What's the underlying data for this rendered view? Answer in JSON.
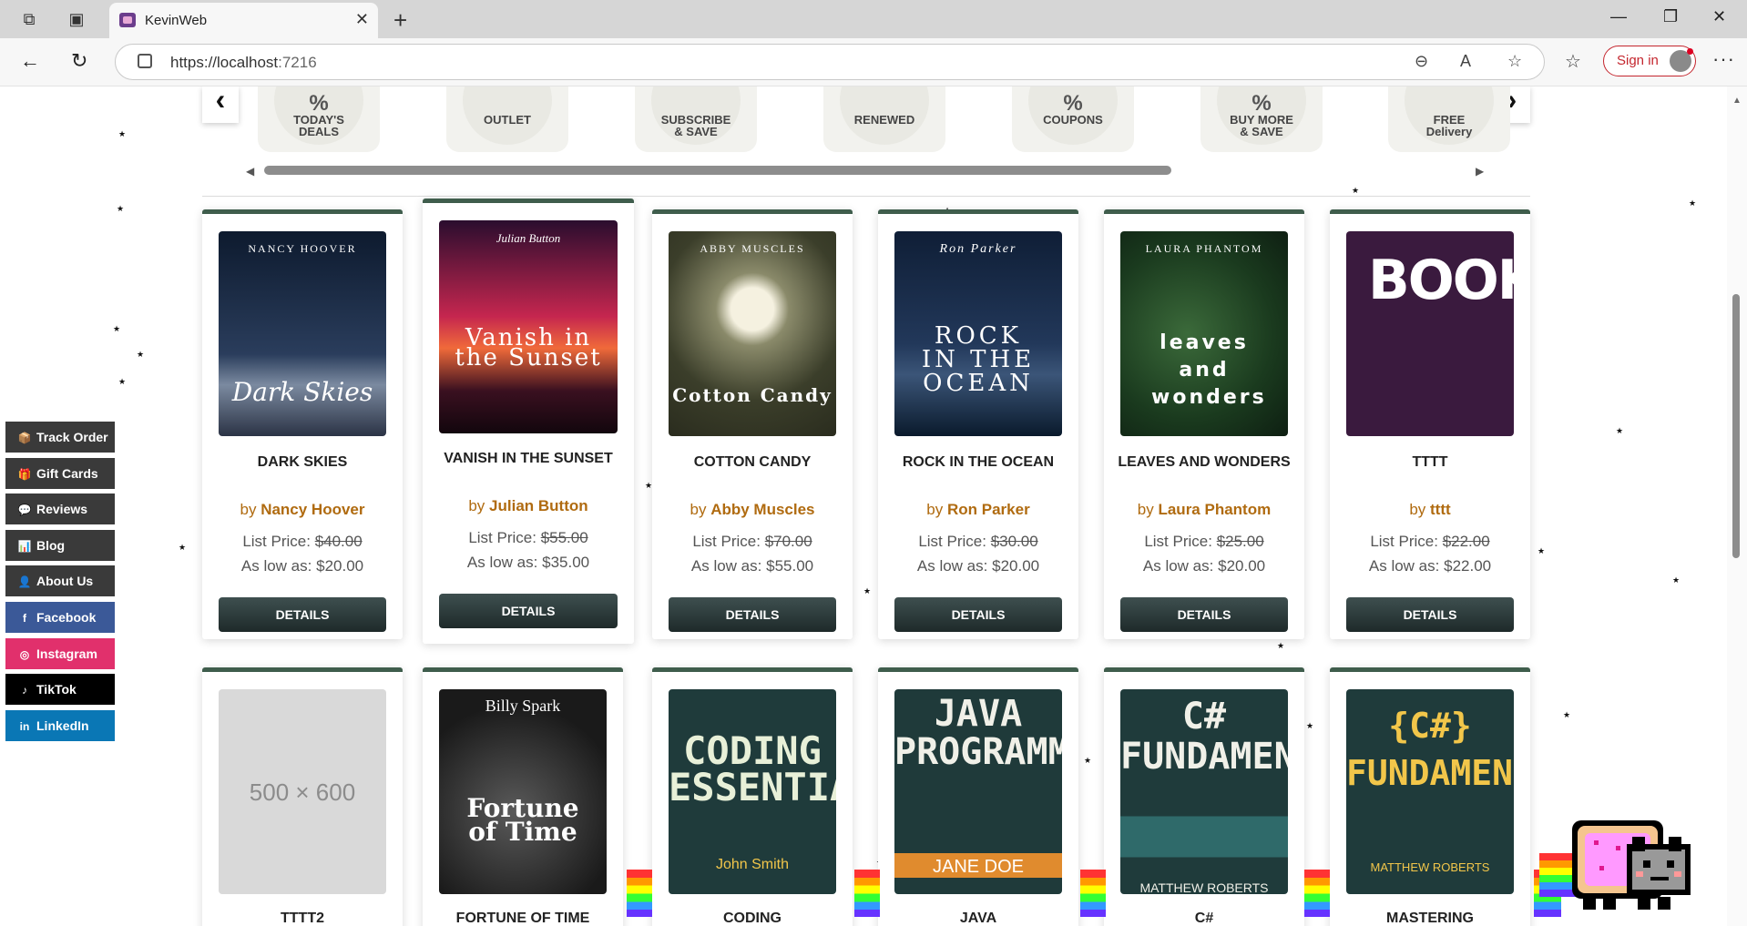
{
  "browser": {
    "tab_title": "KevinWeb",
    "url_scheme_host": "https://localhost",
    "url_port": ":7216",
    "sign_in_label": "Sign in"
  },
  "categories": [
    {
      "mark": "%",
      "label_line1": "TODAY'S",
      "label_line2": "DEALS"
    },
    {
      "mark": "",
      "label_line1": "OUTLET",
      "label_line2": ""
    },
    {
      "mark": "",
      "label_line1": "SUBSCRIBE",
      "label_line2": "& SAVE"
    },
    {
      "mark": "",
      "label_line1": "RENEWED",
      "label_line2": ""
    },
    {
      "mark": "%",
      "label_line1": "COUPONS",
      "label_line2": ""
    },
    {
      "mark": "%",
      "label_line1": "BUY MORE",
      "label_line2": "& SAVE"
    },
    {
      "mark": "",
      "label_line1": "FREE",
      "label_line2": "Delivery"
    }
  ],
  "side_menu": [
    {
      "label": "Track Order",
      "icon": "package-icon",
      "glyph": "📦",
      "color": "#3a3a3a"
    },
    {
      "label": "Gift Cards",
      "icon": "gift-icon",
      "glyph": "🎁",
      "color": "#3a3a3a"
    },
    {
      "label": "Reviews",
      "icon": "speech-bubble-icon",
      "glyph": "💬",
      "color": "#3a3a3a"
    },
    {
      "label": "Blog",
      "icon": "bar-chart-icon",
      "glyph": "📊",
      "color": "#3a3a3a"
    },
    {
      "label": "About Us",
      "icon": "person-icon",
      "glyph": "👤",
      "color": "#3a3a3a"
    },
    {
      "label": "Facebook",
      "icon": "facebook-icon",
      "glyph": "f",
      "color": "#3b5998"
    },
    {
      "label": "Instagram",
      "icon": "instagram-icon",
      "glyph": "◎",
      "color": "#e1306c"
    },
    {
      "label": "TikTok",
      "icon": "tiktok-icon",
      "glyph": "♪",
      "color": "#000000"
    },
    {
      "label": "LinkedIn",
      "icon": "linkedin-icon",
      "glyph": "in",
      "color": "#0a77b5"
    }
  ],
  "labels": {
    "by": "by",
    "list_price": "List Price:",
    "as_low_as": "As low as:",
    "details": "DETAILS"
  },
  "books_row1": [
    {
      "title": "Dark Skies",
      "author": "Nancy Hoover",
      "list_price": "$40.00",
      "low_price": "$20.00",
      "cover_top": "NANCY HOOVER",
      "cover_main": "Dark Skies"
    },
    {
      "title": "Vanish in the Sunset",
      "author": "Julian Button",
      "list_price": "$55.00",
      "low_price": "$35.00",
      "cover_top": "Julian Button",
      "cover_main": "Vanish in the Sunset"
    },
    {
      "title": "Cotton Candy",
      "author": "Abby Muscles",
      "list_price": "$70.00",
      "low_price": "$55.00",
      "cover_top": "ABBY MUSCLES",
      "cover_main": "Cotton Candy"
    },
    {
      "title": "Rock in the Ocean",
      "author": "Ron Parker",
      "list_price": "$30.00",
      "low_price": "$20.00",
      "cover_top": "Ron Parker",
      "cover_main": "ROCK IN THE OCEAN"
    },
    {
      "title": "Leaves and Wonders",
      "author": "Laura Phantom",
      "list_price": "$25.00",
      "low_price": "$20.00",
      "cover_top": "LAURA PHANTOM",
      "cover_main": "leaves and wonders"
    },
    {
      "title": "tttt",
      "author": "tttt",
      "list_price": "$22.00",
      "low_price": "$22.00",
      "cover_top": "",
      "cover_main": "BOOK"
    }
  ],
  "books_row2": [
    {
      "title": "tttt2",
      "cover_top": "",
      "cover_main": "500 × 600",
      "cover_sub": ""
    },
    {
      "title": "Fortune of Time",
      "cover_top": "Billy Spark",
      "cover_main": "Fortune of Time",
      "cover_sub": ""
    },
    {
      "title": "Coding",
      "cover_top": "",
      "cover_main": "CODING ESSENTIALS",
      "cover_sub": "John Smith"
    },
    {
      "title": "Java",
      "cover_top": "",
      "cover_main": "JAVA PROGRAMMING",
      "cover_sub": "JANE DOE"
    },
    {
      "title": "C#",
      "cover_top": "",
      "cover_main": "C# FUNDAMENTALS",
      "cover_sub": "MATTHEW ROBERTS"
    },
    {
      "title": "Mastering",
      "cover_top": "",
      "cover_main": "{C#} FUNDAMENTALS",
      "cover_sub": "MATTHEW ROBERTS"
    }
  ]
}
